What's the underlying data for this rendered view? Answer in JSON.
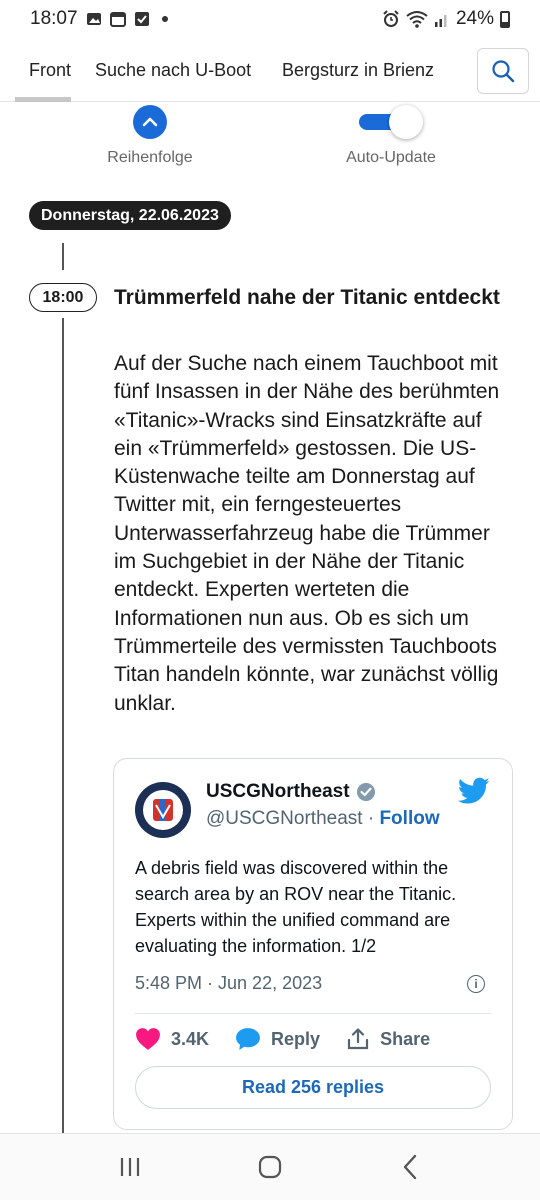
{
  "statusbar": {
    "time": "18:07",
    "battery": "24%"
  },
  "tabs": [
    {
      "label": "Front",
      "active": true
    },
    {
      "label": "Suche nach U-Boot",
      "active": false
    },
    {
      "label": "Bergsturz in Brienz",
      "active": false
    }
  ],
  "controls": {
    "order_label": "Reihenfolge",
    "autoupdate_label": "Auto-Update",
    "autoupdate_on": true
  },
  "feed": {
    "date": "Donnerstag, 22.06.2023",
    "entry": {
      "time": "18:00",
      "headline": "Trümmerfeld nahe der Titanic entdeckt",
      "body": "Auf der Suche nach einem Tauchboot mit fünf Insassen in der Nähe des berühmten «Titanic»-Wracks sind Einsatzkräfte auf ein «Trümmerfeld» gestossen. Die US-Küstenwache teilte am Donnerstag auf Twitter mit, ein ferngesteuertes Unterwasserfahrzeug habe die Trümmer im Suchgebiet in der Nähe der Titanic entdeckt. Experten werteten die Informationen nun aus. Ob es sich um Trümmerteile des vermissten Tauchboots Titan handeln könnte, war zunächst völlig unklar."
    }
  },
  "tweet": {
    "name": "USCGNortheast",
    "handle": "@USCGNortheast",
    "separator": "·",
    "follow_label": "Follow",
    "text": "A debris field was discovered within the search area by an ROV near the Titanic. Experts within the unified command are evaluating the information. 1/2",
    "timestamp": "5:48 PM · Jun 22, 2023",
    "likes": "3.4K",
    "reply_label": "Reply",
    "share_label": "Share",
    "read_replies_label": "Read 256 replies"
  },
  "colors": {
    "accent": "#1a6bd8",
    "twitter_blue": "#1d9bf0",
    "heart": "#f91880",
    "pill_dark": "#1f1f1f"
  }
}
